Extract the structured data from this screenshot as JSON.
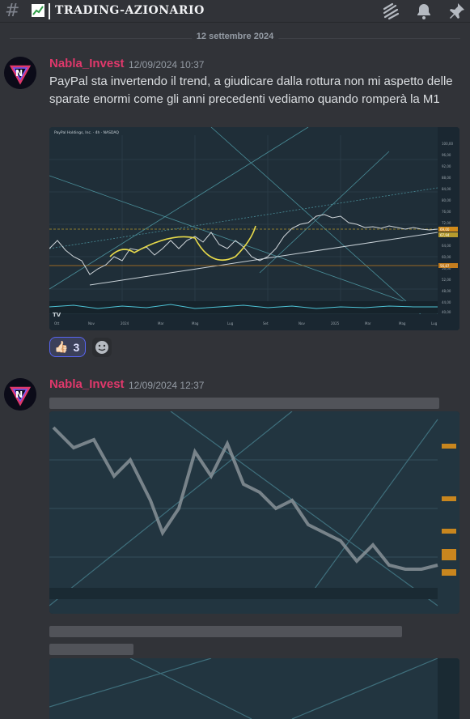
{
  "channel": {
    "name": "TRADING-AZIONARIO",
    "hash_symbol": "#"
  },
  "header_icons": [
    "threads-icon",
    "bell-icon",
    "pin-icon"
  ],
  "date_divider": "12 settembre 2024",
  "messages": [
    {
      "author": "Nabla_Invest",
      "timestamp": "12/09/2024 10:37",
      "text": "PayPal sta invertendo il trend, a giudicare dalla rottura non mi aspetto delle sparate enormi come gli anni precedenti vediamo quando romperà la M1",
      "attachment": {
        "title": "PayPal Holdings, Inc. · 4h · NASDAQ",
        "x_labels": [
          "Ott",
          "Nov",
          "2024",
          "Mar",
          "Mag",
          "Lug",
          "Set",
          "Nov",
          "2025",
          "Mar",
          "Mag",
          "Lug"
        ],
        "price_labels": [
          "100,00",
          "96,00",
          "92,00",
          "88,00",
          "84,00",
          "80,00",
          "76,00",
          "72,00",
          "68,00",
          "64,00",
          "60,00",
          "56,00",
          "52,00",
          "48,00",
          "44,00",
          "40,00"
        ],
        "badges": [
          "69,00",
          "67,94",
          "56,87"
        ],
        "logo": "TV"
      },
      "reactions": [
        {
          "emoji": "👍🏻",
          "count": "3"
        }
      ]
    },
    {
      "author": "Nabla_Invest",
      "timestamp": "12/09/2024 12:37"
    }
  ],
  "colors": {
    "username": "#e0386b",
    "background": "#313338",
    "accent": "#5865f2"
  }
}
